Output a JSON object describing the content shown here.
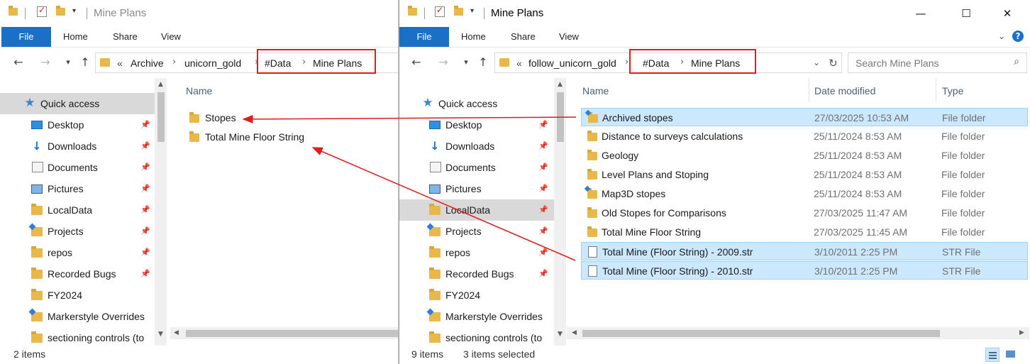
{
  "left_window": {
    "title": "Mine Plans",
    "ribbon_tabs": [
      "File",
      "Home",
      "Share",
      "View"
    ],
    "breadcrumb": {
      "overflow": "«",
      "items": [
        "Archive",
        "unicorn_gold",
        "#Data",
        "Mine Plans"
      ]
    },
    "nav_items": [
      {
        "label": "Quick access",
        "icon": "star-icon"
      },
      {
        "label": "Desktop",
        "icon": "desktop-icon",
        "pinned": true
      },
      {
        "label": "Downloads",
        "icon": "download-icon",
        "pinned": true
      },
      {
        "label": "Documents",
        "icon": "documents-icon",
        "pinned": true
      },
      {
        "label": "Pictures",
        "icon": "pictures-icon",
        "pinned": true
      },
      {
        "label": "LocalData",
        "icon": "folder-icon",
        "pinned": true
      },
      {
        "label": "Projects",
        "icon": "shared-folder-icon",
        "pinned": true
      },
      {
        "label": "repos",
        "icon": "folder-icon",
        "pinned": true
      },
      {
        "label": "Recorded Bugs",
        "icon": "folder-icon",
        "pinned": true
      },
      {
        "label": "FY2024",
        "icon": "folder-icon"
      },
      {
        "label": "Markerstyle Overrides",
        "icon": "shared-folder-icon"
      },
      {
        "label": "sectioning controls (to",
        "icon": "folder-icon"
      }
    ],
    "columns": [
      "Name"
    ],
    "files": [
      {
        "name": "Stopes"
      },
      {
        "name": "Total Mine Floor String"
      }
    ],
    "status": "2 items"
  },
  "right_window": {
    "title": "Mine Plans",
    "ribbon_tabs": [
      "File",
      "Home",
      "Share",
      "View"
    ],
    "breadcrumb": {
      "overflow": "«",
      "items": [
        "follow_unicorn_gold",
        "#Data",
        "Mine Plans"
      ]
    },
    "search_placeholder": "Search Mine Plans",
    "nav_items": [
      {
        "label": "Quick access",
        "icon": "star-icon"
      },
      {
        "label": "Desktop",
        "icon": "desktop-icon",
        "pinned": true
      },
      {
        "label": "Downloads",
        "icon": "download-icon",
        "pinned": true
      },
      {
        "label": "Documents",
        "icon": "documents-icon",
        "pinned": true
      },
      {
        "label": "Pictures",
        "icon": "pictures-icon",
        "pinned": true
      },
      {
        "label": "LocalData",
        "icon": "folder-icon",
        "pinned": true,
        "selected": true
      },
      {
        "label": "Projects",
        "icon": "shared-folder-icon",
        "pinned": true
      },
      {
        "label": "repos",
        "icon": "folder-icon",
        "pinned": true
      },
      {
        "label": "Recorded Bugs",
        "icon": "folder-icon",
        "pinned": true
      },
      {
        "label": "FY2024",
        "icon": "folder-icon"
      },
      {
        "label": "Markerstyle Overrides",
        "icon": "shared-folder-icon"
      },
      {
        "label": "sectioning controls (to",
        "icon": "folder-icon"
      }
    ],
    "columns": [
      "Name",
      "Date modified",
      "Type"
    ],
    "files": [
      {
        "name": "Archived stopes",
        "date": "27/03/2025 10:53 AM",
        "type": "File folder",
        "selected": true,
        "icon": "shared-folder-icon"
      },
      {
        "name": "Distance to surveys calculations",
        "date": "25/11/2024 8:53 AM",
        "type": "File folder",
        "icon": "folder-icon"
      },
      {
        "name": "Geology",
        "date": "25/11/2024 8:53 AM",
        "type": "File folder",
        "icon": "folder-icon"
      },
      {
        "name": "Level Plans and Stoping",
        "date": "25/11/2024 8:53 AM",
        "type": "File folder",
        "icon": "folder-icon"
      },
      {
        "name": "Map3D stopes",
        "date": "25/11/2024 8:53 AM",
        "type": "File folder",
        "icon": "shared-folder-icon"
      },
      {
        "name": "Old Stopes for Comparisons",
        "date": "27/03/2025 11:47 AM",
        "type": "File folder",
        "icon": "folder-icon"
      },
      {
        "name": "Total Mine Floor String",
        "date": "27/03/2025 11:45 AM",
        "type": "File folder",
        "icon": "folder-icon"
      },
      {
        "name": "Total Mine (Floor String) - 2009.str",
        "date": "3/10/2011 2:25 PM",
        "type": "STR File",
        "selected": true,
        "icon": "file-icon"
      },
      {
        "name": "Total Mine (Floor String) - 2010.str",
        "date": "3/10/2011 2:25 PM",
        "type": "STR File",
        "selected": true,
        "icon": "file-icon"
      }
    ],
    "status_count": "9 items",
    "status_selected": "3 items selected"
  },
  "colors": {
    "accent": "#1a6fc7",
    "highlight_box": "#e21b1b",
    "selection_fill": "#cce8ff",
    "folder": "#e8b84a"
  }
}
